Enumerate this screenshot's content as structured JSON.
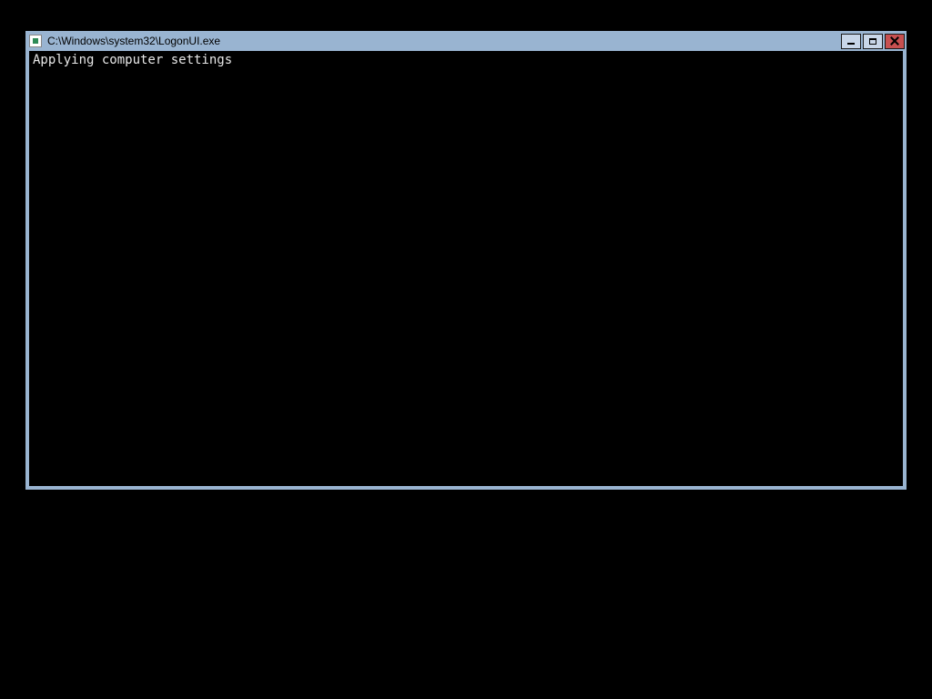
{
  "window": {
    "title": "C:\\Windows\\system32\\LogonUI.exe"
  },
  "console": {
    "line1": "Applying computer settings"
  }
}
